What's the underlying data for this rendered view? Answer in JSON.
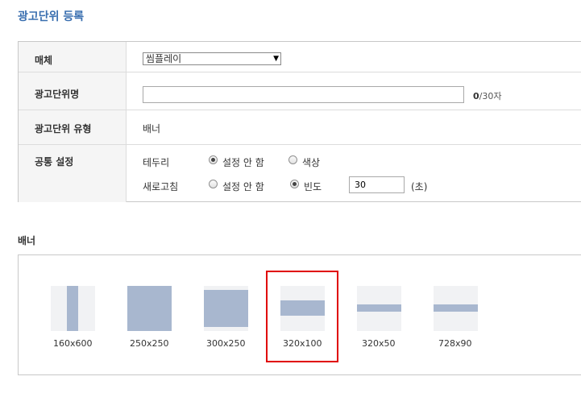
{
  "page": {
    "title": "광고단위 등록"
  },
  "form": {
    "media": {
      "label": "매체",
      "selected": "씸플레이"
    },
    "unit_name": {
      "label": "광고단위명",
      "value": "",
      "count": "0",
      "max": "/30자"
    },
    "unit_type": {
      "label": "광고단위 유형",
      "value": "배너"
    },
    "common": {
      "label": "공통 설정",
      "border": {
        "label": "테두리",
        "option_none": "설정 안 함",
        "option_color": "색상",
        "selected": "none"
      },
      "refresh": {
        "label": "새로고침",
        "option_none": "설정 안 함",
        "option_freq": "빈도",
        "freq_value": "30",
        "unit": "(초)",
        "selected": "freq"
      }
    }
  },
  "banner_section": {
    "title": "배너",
    "selected_index": 3,
    "items": [
      {
        "label": "160x600"
      },
      {
        "label": "250x250"
      },
      {
        "label": "300x250"
      },
      {
        "label": "320x100"
      },
      {
        "label": "320x50"
      },
      {
        "label": "728x90"
      }
    ]
  },
  "colors": {
    "title": "#3a6fb0",
    "thumb_bg": "#f1f2f4",
    "thumb_fill": "#a8b7cf",
    "selection": "#e00000"
  }
}
